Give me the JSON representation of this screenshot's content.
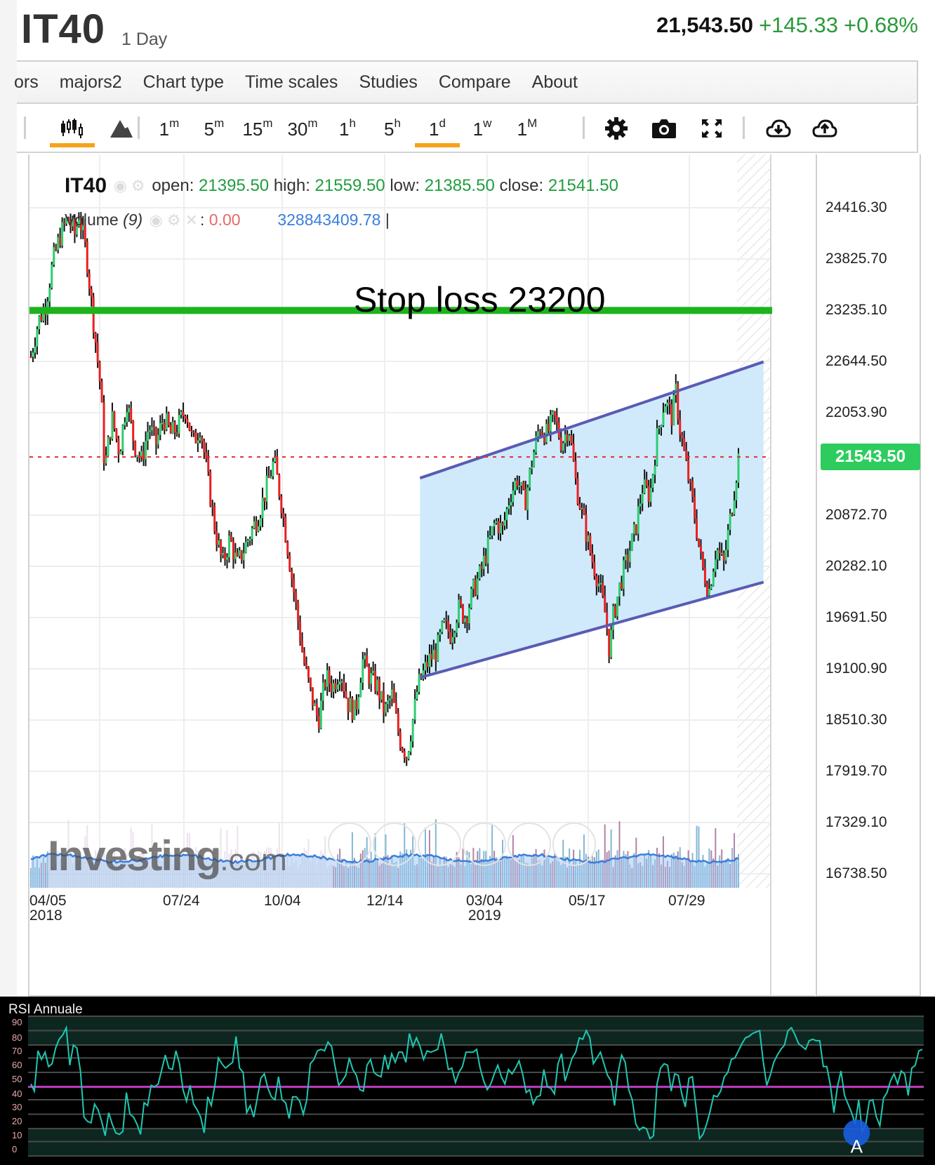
{
  "header": {
    "symbol": "IT40",
    "interval": "1 Day",
    "last_price": "21,543.50",
    "change": "+145.33",
    "change_pct": "+0.68%"
  },
  "menu": {
    "items": [
      "ors",
      "majors2",
      "Chart type",
      "Time scales",
      "Studies",
      "Compare",
      "About"
    ]
  },
  "toolbar": {
    "chart_types": [
      {
        "name": "candlestick-icon",
        "active": true
      },
      {
        "name": "mountain-chart-icon",
        "active": false
      }
    ],
    "timeframes": [
      {
        "num": "1",
        "unit": "m",
        "active": false
      },
      {
        "num": "5",
        "unit": "m",
        "active": false
      },
      {
        "num": "15",
        "unit": "m",
        "active": false
      },
      {
        "num": "30",
        "unit": "m",
        "active": false
      },
      {
        "num": "1",
        "unit": "h",
        "active": false
      },
      {
        "num": "5",
        "unit": "h",
        "active": false
      },
      {
        "num": "1",
        "unit": "d",
        "active": true
      },
      {
        "num": "1",
        "unit": "w",
        "active": false
      },
      {
        "num": "1",
        "unit": "M",
        "active": false
      }
    ],
    "tools": [
      "gear-icon",
      "camera-icon",
      "fullscreen-icon",
      "cloud-download-icon",
      "cloud-upload-icon"
    ],
    "accent_color": "#f7a21b"
  },
  "legend": {
    "symbol": "IT40",
    "open_label": "open:",
    "open": "21395.50",
    "high_label": "high:",
    "high": "21559.50",
    "low_label": "low:",
    "low": "21385.50",
    "close_label": "close:",
    "close": "21541.50",
    "volume_label": "Volume",
    "volume_period": "(9)",
    "volume_value": "0.00",
    "volume_ma": "328843409.78"
  },
  "annotations": {
    "stop_loss_label": "Stop loss 23200",
    "stop_loss_level": 23200,
    "stop_loss_color": "#1db31d",
    "current_price_tag": "21543.50",
    "current_price": 21543.5,
    "channel": {
      "fill": "#cde9fb",
      "line_color": "#5a5bb5",
      "upper": {
        "start_date": "2018-12-31",
        "start_price": 21300,
        "end_date": "2019-09-06",
        "end_price": 22640
      },
      "lower": {
        "start_date": "2018-12-31",
        "start_price": 19000,
        "end_date": "2019-09-06",
        "end_price": 20100
      }
    }
  },
  "watermark": {
    "main": "Investing",
    "suffix": ".com"
  },
  "chart_data": [
    {
      "type": "candlestick",
      "title": "IT40 1 Day",
      "xlabel": "",
      "ylabel": "",
      "ylim": [
        16500,
        24700
      ],
      "yticks": [
        "24416.30",
        "23825.70",
        "23235.10",
        "22644.50",
        "22053.90",
        "21543.50",
        "20872.70",
        "20282.10",
        "19691.50",
        "19100.90",
        "18510.30",
        "17919.70",
        "17329.10",
        "16738.50"
      ],
      "ytick_values": [
        24416.3,
        23825.7,
        23235.1,
        22644.5,
        22053.9,
        20872.7,
        20282.1,
        19691.5,
        19100.9,
        18510.3,
        17919.7,
        17329.1,
        16738.5
      ],
      "xticks": [
        {
          "label": "04/05",
          "sub": "2018"
        },
        {
          "label": "07/24",
          "sub": ""
        },
        {
          "label": "10/04",
          "sub": ""
        },
        {
          "label": "12/14",
          "sub": ""
        },
        {
          "label": "03/04",
          "sub": "2019"
        },
        {
          "label": "05/17",
          "sub": ""
        },
        {
          "label": "07/29",
          "sub": ""
        }
      ],
      "grid": true,
      "up_color": "#2ecc71",
      "down_color": "#e82020",
      "close_path": [
        [
          0,
          22700
        ],
        [
          0.01,
          23100
        ],
        [
          0.02,
          23300
        ],
        [
          0.03,
          23800
        ],
        [
          0.04,
          24100
        ],
        [
          0.05,
          24300
        ],
        [
          0.06,
          24100
        ],
        [
          0.065,
          24350
        ],
        [
          0.075,
          23900
        ],
        [
          0.085,
          23100
        ],
        [
          0.095,
          22300
        ],
        [
          0.1,
          21400
        ],
        [
          0.11,
          22000
        ],
        [
          0.12,
          21600
        ],
        [
          0.13,
          22200
        ],
        [
          0.14,
          21700
        ],
        [
          0.15,
          21500
        ],
        [
          0.16,
          21900
        ],
        [
          0.17,
          21700
        ],
        [
          0.18,
          22000
        ],
        [
          0.19,
          21800
        ],
        [
          0.2,
          21900
        ],
        [
          0.21,
          22100
        ],
        [
          0.22,
          21700
        ],
        [
          0.23,
          21900
        ],
        [
          0.24,
          21300
        ],
        [
          0.25,
          20700
        ],
        [
          0.26,
          20300
        ],
        [
          0.27,
          20600
        ],
        [
          0.28,
          20300
        ],
        [
          0.29,
          20500
        ],
        [
          0.3,
          20700
        ],
        [
          0.31,
          20900
        ],
        [
          0.32,
          21200
        ],
        [
          0.33,
          21500
        ],
        [
          0.34,
          21000
        ],
        [
          0.35,
          20400
        ],
        [
          0.36,
          19800
        ],
        [
          0.37,
          19200
        ],
        [
          0.38,
          18800
        ],
        [
          0.39,
          18500
        ],
        [
          0.4,
          19000
        ],
        [
          0.41,
          18900
        ],
        [
          0.42,
          19100
        ],
        [
          0.43,
          18700
        ],
        [
          0.44,
          18600
        ],
        [
          0.45,
          19200
        ],
        [
          0.46,
          19000
        ],
        [
          0.47,
          18900
        ],
        [
          0.48,
          18600
        ],
        [
          0.49,
          18800
        ],
        [
          0.5,
          18300
        ],
        [
          0.51,
          18100
        ],
        [
          0.52,
          18600
        ],
        [
          0.525,
          18900
        ],
        [
          0.54,
          19200
        ],
        [
          0.55,
          19300
        ],
        [
          0.56,
          19600
        ],
        [
          0.57,
          19500
        ],
        [
          0.58,
          19800
        ],
        [
          0.59,
          19700
        ],
        [
          0.6,
          20000
        ],
        [
          0.61,
          20200
        ],
        [
          0.62,
          20500
        ],
        [
          0.63,
          20800
        ],
        [
          0.64,
          20700
        ],
        [
          0.65,
          21100
        ],
        [
          0.66,
          21300
        ],
        [
          0.67,
          21000
        ],
        [
          0.68,
          21500
        ],
        [
          0.69,
          21900
        ],
        [
          0.7,
          21800
        ],
        [
          0.71,
          22000
        ],
        [
          0.72,
          21700
        ],
        [
          0.73,
          21900
        ],
        [
          0.74,
          21200
        ],
        [
          0.75,
          20800
        ],
        [
          0.76,
          20400
        ],
        [
          0.77,
          20100
        ],
        [
          0.78,
          19700
        ],
        [
          0.785,
          19300
        ],
        [
          0.79,
          19700
        ],
        [
          0.8,
          20100
        ],
        [
          0.81,
          20400
        ],
        [
          0.82,
          20700
        ],
        [
          0.83,
          21200
        ],
        [
          0.84,
          21100
        ],
        [
          0.85,
          21800
        ],
        [
          0.86,
          22200
        ],
        [
          0.87,
          22000
        ],
        [
          0.875,
          22300
        ],
        [
          0.88,
          21900
        ],
        [
          0.89,
          21400
        ],
        [
          0.9,
          20900
        ],
        [
          0.91,
          20300
        ],
        [
          0.92,
          20000
        ],
        [
          0.93,
          20500
        ],
        [
          0.94,
          20300
        ],
        [
          0.95,
          20900
        ],
        [
          0.955,
          21200
        ],
        [
          0.96,
          21543.5
        ]
      ]
    },
    {
      "type": "bar",
      "title": "Volume (9)",
      "note": "volume histogram with 9-period moving average; values not labeled",
      "ma_color": "#3a7edb"
    },
    {
      "type": "line",
      "title": "RSI Annuale",
      "ylim": [
        0,
        95
      ],
      "yticks": [
        "90",
        "80",
        "70",
        "60",
        "50",
        "40",
        "30",
        "20",
        "10",
        "0"
      ],
      "midline": 46,
      "midline_color": "#c03cc0",
      "line_color": "#1fc8b0",
      "marker": {
        "label": "A",
        "x": 0.925,
        "y": 14,
        "color": "#1a5de0"
      },
      "values": [
        48,
        43,
        71,
        65,
        70,
        60,
        62,
        73,
        79,
        82,
        87,
        61,
        75,
        73,
        57,
        25,
        22,
        21,
        34,
        30,
        22,
        12,
        28,
        20,
        14,
        13,
        15,
        42,
        27,
        25,
        20,
        13,
        35,
        33,
        47,
        46,
        48,
        58,
        68,
        59,
        58,
        71,
        62,
        44,
        36,
        47,
        34,
        30,
        25,
        14,
        39,
        33,
        47,
        66,
        62,
        59,
        61,
        63,
        81,
        59,
        56,
        28,
        33,
        25,
        38,
        52,
        55,
        45,
        39,
        37,
        53,
        37,
        35,
        24,
        39,
        39,
        36,
        27,
        37,
        62,
        65,
        71,
        72,
        71,
        77,
        74,
        60,
        47,
        50,
        54,
        66,
        58,
        54,
        44,
        43,
        61,
        65,
        56,
        54,
        53,
        68,
        58,
        69,
        63,
        70,
        70,
        63,
        83,
        74,
        80,
        74,
        65,
        71,
        70,
        71,
        72,
        83,
        72,
        58,
        59,
        49,
        56,
        60,
        70,
        70,
        70,
        72,
        59,
        50,
        44,
        48,
        55,
        61,
        53,
        48,
        58,
        55,
        59,
        64,
        55,
        42,
        44,
        34,
        39,
        40,
        58,
        46,
        45,
        41,
        62,
        69,
        50,
        58,
        66,
        70,
        80,
        79,
        85,
        80,
        62,
        66,
        70,
        62,
        54,
        50,
        33,
        56,
        68,
        63,
        44,
        37,
        20,
        16,
        18,
        17,
        10,
        12,
        48,
        59,
        62,
        61,
        43,
        55,
        54,
        41,
        32,
        52,
        53,
        32,
        10,
        13,
        20,
        29,
        40,
        39,
        43,
        53,
        56,
        65,
        66,
        71,
        76,
        80,
        81,
        83,
        84,
        85,
        64,
        47,
        54,
        63,
        68,
        72,
        75,
        85,
        87,
        82,
        76,
        74,
        72,
        78,
        79,
        78,
        78,
        60,
        60,
        47,
        28,
        46,
        57,
        40,
        34,
        28,
        20,
        37,
        15,
        20,
        36,
        37,
        25,
        19,
        38,
        42,
        50,
        55,
        48,
        57,
        55,
        40,
        59,
        61,
        71,
        72
      ]
    }
  ]
}
